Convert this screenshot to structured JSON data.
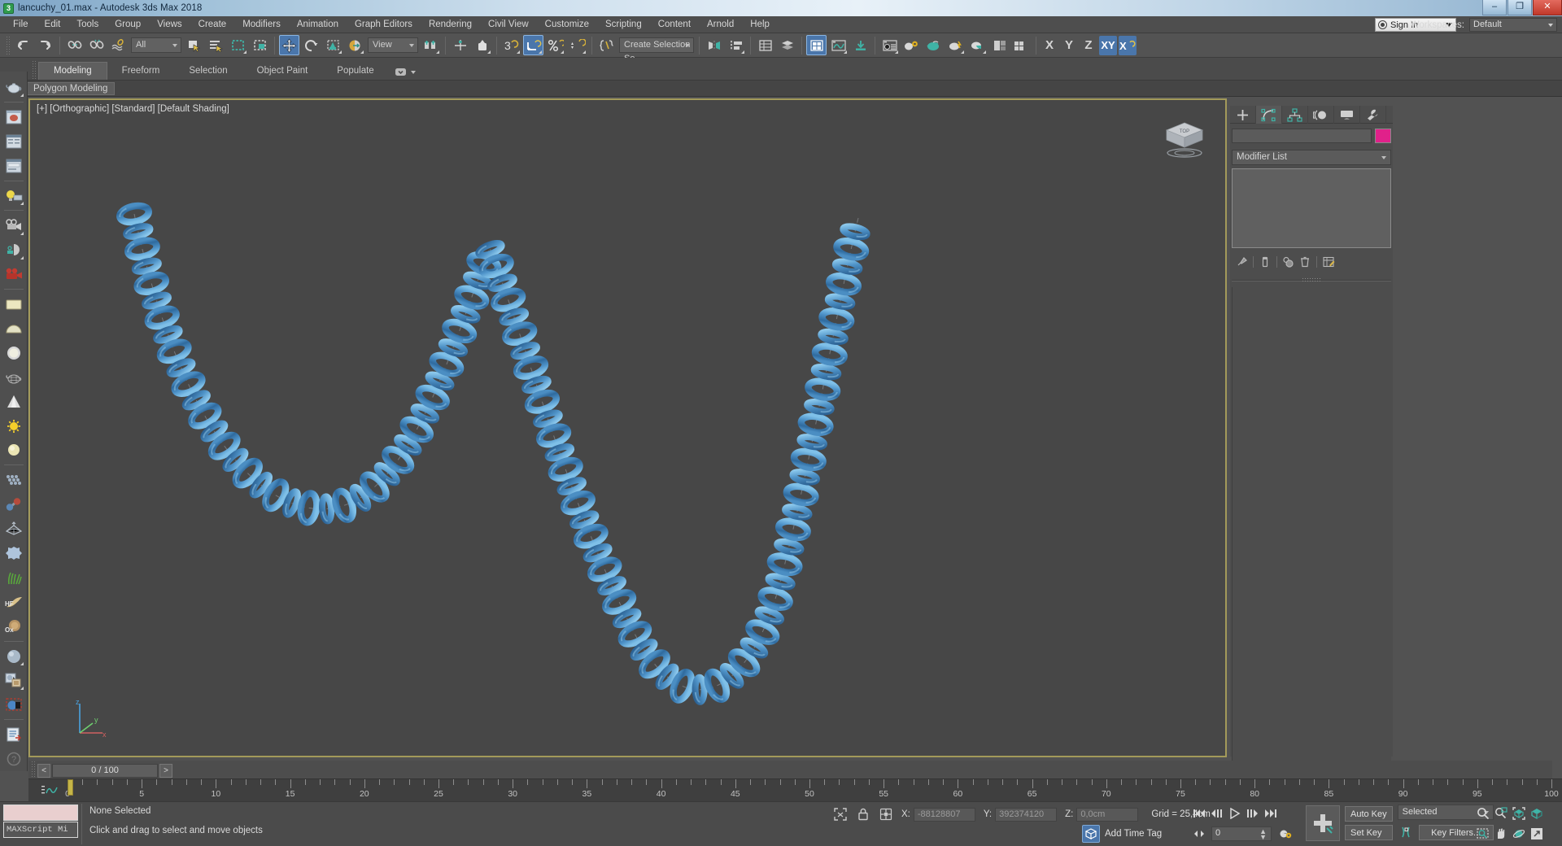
{
  "window": {
    "title": "lancuchy_01.max - Autodesk 3ds Max 2018",
    "app_icon": "3",
    "minimize": "–",
    "maximize": "❐",
    "close": "✕"
  },
  "menubar": {
    "items": [
      {
        "label": "File"
      },
      {
        "label": "Edit"
      },
      {
        "label": "Tools"
      },
      {
        "label": "Group"
      },
      {
        "label": "Views"
      },
      {
        "label": "Create"
      },
      {
        "label": "Modifiers"
      },
      {
        "label": "Animation"
      },
      {
        "label": "Graph Editors"
      },
      {
        "label": "Rendering"
      },
      {
        "label": "Civil View"
      },
      {
        "label": "Customize"
      },
      {
        "label": "Scripting"
      },
      {
        "label": "Content"
      },
      {
        "label": "Arnold"
      },
      {
        "label": "Help"
      }
    ],
    "sign_in": "Sign In",
    "workspaces_label": "Workspaces:",
    "workspace_value": "Default"
  },
  "toolbar": {
    "selection_filter": "All",
    "reference_coord": "View",
    "selection_set": "Create Selection Se",
    "axis_x": "X",
    "axis_y": "Y",
    "axis_z": "Z",
    "axis_xy": "XY",
    "icons": [
      "undo-icon",
      "redo-icon",
      "select-link-icon",
      "unlink-icon",
      "bind-space-warp-icon",
      "select-object-icon",
      "select-by-name-icon",
      "rectangular-select-region-icon",
      "window-crossing-icon",
      "select-and-move-icon",
      "select-and-rotate-icon",
      "select-and-scale-icon",
      "select-and-place-icon",
      "snaps-toggle-icon",
      "angle-snap-icon",
      "percent-snap-icon",
      "spinner-snap-icon",
      "edit-named-selection-icon",
      "mirror-icon",
      "align-icon",
      "layer-explorer-icon",
      "scene-explorer-icon",
      "curve-editor-icon",
      "schematic-view-icon",
      "compact-material-editor-icon",
      "render-setup-icon",
      "rendered-frame-icon",
      "render-production-icon",
      "render-iterative-icon",
      "active-shade-icon",
      "render-in-cloud-icon",
      "open-ui-icon"
    ]
  },
  "ribbon": {
    "tabs": [
      {
        "label": "Modeling",
        "active": true
      },
      {
        "label": "Freeform",
        "active": false
      },
      {
        "label": "Selection",
        "active": false
      },
      {
        "label": "Object Paint",
        "active": false
      },
      {
        "label": "Populate",
        "active": false
      }
    ],
    "panel_label": "Polygon Modeling"
  },
  "left_toolbar": {
    "icons": [
      "teapot-icon",
      "render-frame-window-icon",
      "render-setup-icon",
      "render-settings-icon",
      "light-lister-icon",
      "camera-icon",
      "camera-match-icon",
      "video-camera-icon",
      "plane-primitive-icon",
      "dome-icon",
      "sphere-primitive-icon",
      "teapot-wire-icon",
      "cone-primitive-icon",
      "sun-light-icon",
      "sphere-light-icon",
      "matrix-array-icon",
      "atom-bond-icon",
      "pyramid-wire-icon",
      "noise-ball-icon",
      "grass-icon",
      "hair-fur-icon",
      "ox-hair-icon",
      "material-sphere-icon",
      "material-map-browser-icon",
      "material-region-icon",
      "script-listener-icon",
      "help-icon"
    ]
  },
  "viewport": {
    "label": "[+] [Orthographic] [Standard] [Default Shading]",
    "view_cube_label": "TOP",
    "axis_x": "x",
    "axis_y": "y",
    "axis_z": "z",
    "scene_object": "chain-necklace-mesh",
    "chain_color": "#5a9fd4"
  },
  "command_panel": {
    "tabs": [
      {
        "name": "create-tab",
        "icon": "plus-icon",
        "active": false
      },
      {
        "name": "modify-tab",
        "icon": "modify-curve-icon",
        "active": true
      },
      {
        "name": "hierarchy-tab",
        "icon": "hierarchy-icon",
        "active": false
      },
      {
        "name": "motion-tab",
        "icon": "motion-wheel-icon",
        "active": false
      },
      {
        "name": "display-tab",
        "icon": "display-monitor-icon",
        "active": false
      },
      {
        "name": "utilities-tab",
        "icon": "wrench-icon",
        "active": false
      }
    ],
    "object_name": "",
    "color_swatch": "#e0218a",
    "modifier_list_label": "Modifier List",
    "stack_items": [],
    "stack_icons": [
      "pin-stack-icon",
      "show-end-result-icon",
      "make-unique-icon",
      "remove-modifier-icon",
      "configure-sets-icon"
    ]
  },
  "timeline": {
    "prev_label": "<",
    "next_label": ">",
    "frame_field": "0 / 100",
    "ruler_ticks": [
      {
        "label": "0",
        "value": 0
      },
      {
        "label": "5",
        "value": 5
      },
      {
        "label": "10",
        "value": 10
      },
      {
        "label": "15",
        "value": 15
      },
      {
        "label": "20",
        "value": 20
      },
      {
        "label": "25",
        "value": 25
      },
      {
        "label": "30",
        "value": 30
      },
      {
        "label": "35",
        "value": 35
      },
      {
        "label": "40",
        "value": 40
      },
      {
        "label": "45",
        "value": 45
      },
      {
        "label": "50",
        "value": 50
      },
      {
        "label": "55",
        "value": 55
      },
      {
        "label": "60",
        "value": 60
      },
      {
        "label": "65",
        "value": 65
      },
      {
        "label": "70",
        "value": 70
      },
      {
        "label": "75",
        "value": 75
      },
      {
        "label": "80",
        "value": 80
      },
      {
        "label": "85",
        "value": 85
      },
      {
        "label": "90",
        "value": 90
      },
      {
        "label": "95",
        "value": 95
      },
      {
        "label": "100",
        "value": 100
      }
    ],
    "current_frame": 0
  },
  "status_bar": {
    "maxscript_mini_listener": "MAXScript Mi",
    "selection_status": "None Selected",
    "prompt": "Click and drag to select and move objects",
    "coord_x_label": "X:",
    "coord_x_value": "-88128807",
    "coord_y_label": "Y:",
    "coord_y_value": "392374120",
    "coord_z_label": "Z:",
    "coord_z_value": "0,0cm",
    "grid_info": "Grid = 25,4cm",
    "add_time_tag": "Add Time Tag",
    "auto_key": "Auto Key",
    "set_key": "Set Key",
    "key_mode_filter": "Selected",
    "key_filters": "Key Filters...",
    "key_frame_value": "0",
    "nav_icons": [
      "go-to-start-icon",
      "previous-frame-icon",
      "play-animation-icon",
      "next-frame-icon",
      "go-to-end-icon",
      "key-mode-toggle-icon",
      "time-configuration-icon",
      "set-key-mode-icon"
    ],
    "view_nav_icons": [
      "zoom-icon",
      "zoom-all-icon",
      "zoom-extents-icon",
      "zoom-extents-selected-icon",
      "zoom-region-icon",
      "pan-view-icon",
      "orbit-icon",
      "maximize-viewport-toggle-icon"
    ]
  }
}
